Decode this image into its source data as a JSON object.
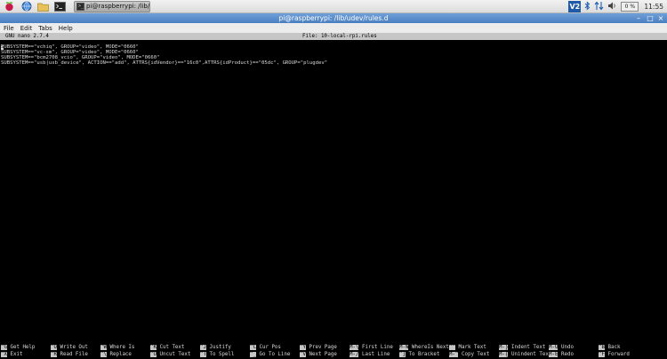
{
  "panel": {
    "launchers": [
      "raspberry-icon",
      "globe-icon",
      "folder-icon",
      "terminal-icon"
    ],
    "task": {
      "label": "pi@raspberrypi: /lib/u..."
    },
    "tray": {
      "vnc": "V2",
      "bluetooth": "bluetooth-icon",
      "network": "network-arrows-icon",
      "volume": "volume-icon",
      "cpu": "0 %",
      "clock": "11:55"
    }
  },
  "window": {
    "title": "pi@raspberrypi: /lib/udev/rules.d"
  },
  "menu": [
    "File",
    "Edit",
    "Tabs",
    "Help"
  ],
  "nano": {
    "version": "GNU nano 2.7.4",
    "file": "File: 10-local-rpi.rules",
    "first_char": "S",
    "first_rest": "UBSYSTEM==\"vchiq\", GROUP=\"video\", MODE=\"0660\"",
    "lines": [
      "SUBSYSTEM==\"vc-sm\", GROUP=\"video\", MODE=\"0660\"",
      "SUBSYSTEM==\"bcm2708_vcio\", GROUP=\"video\", MODE=\"0660\"",
      "SUBSYSTEM==\"usb|usb_device\", ACTION==\"add\", ATTRS{idVendor}==\"16c0\",ATTRS{idProduct}==\"05dc\", GROUP=\"plugdev\""
    ],
    "shortcuts": [
      {
        "k1": "^G",
        "l1": "Get Help",
        "k2": "^X",
        "l2": "Exit"
      },
      {
        "k1": "^O",
        "l1": "Write Out",
        "k2": "^R",
        "l2": "Read File"
      },
      {
        "k1": "^W",
        "l1": "Where Is",
        "k2": "^\\",
        "l2": "Replace"
      },
      {
        "k1": "^K",
        "l1": "Cut Text",
        "k2": "^U",
        "l2": "Uncut Text"
      },
      {
        "k1": "^J",
        "l1": "Justify",
        "k2": "^T",
        "l2": "To Spell"
      },
      {
        "k1": "^C",
        "l1": "Cur Pos",
        "k2": "^_",
        "l2": "Go To Line"
      },
      {
        "k1": "^Y",
        "l1": "Prev Page",
        "k2": "^V",
        "l2": "Next Page"
      },
      {
        "k1": "M-\\",
        "l1": "First Line",
        "k2": "M-/",
        "l2": "Last Line"
      },
      {
        "k1": "M-W",
        "l1": "WhereIs Next",
        "k2": "^]",
        "l2": "To Bracket"
      },
      {
        "k1": "^^",
        "l1": "Mark Text",
        "k2": "M-^",
        "l2": "Copy Text"
      },
      {
        "k1": "M-}",
        "l1": "Indent Text",
        "k2": "M-{",
        "l2": "Unindent Text"
      },
      {
        "k1": "M-U",
        "l1": "Undo",
        "k2": "M-E",
        "l2": "Redo"
      },
      {
        "k1": "^B",
        "l1": "Back",
        "k2": "^F",
        "l2": "Forward"
      }
    ]
  }
}
